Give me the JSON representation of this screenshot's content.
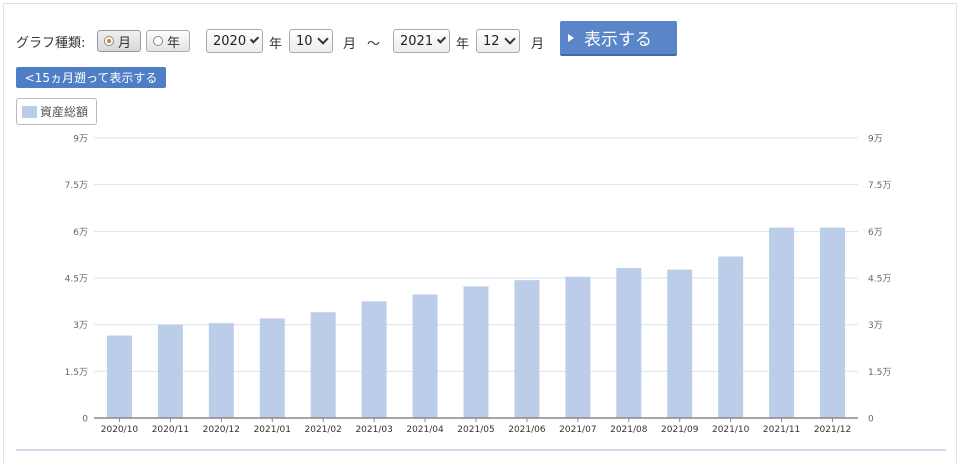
{
  "controls": {
    "graph_type_label": "グラフ種類:",
    "month_option": "月",
    "year_option": "年",
    "start_year": "2020",
    "year_unit_1": "年",
    "start_month": "10",
    "month_unit_1": "月",
    "range_sep": "～",
    "end_year": "2021",
    "year_unit_2": "年",
    "end_month": "12",
    "month_unit_2": "月",
    "show_button": "表示する",
    "back_button": "<15ヵ月遡って表示する"
  },
  "legend": {
    "label": "資産総額"
  },
  "colors": {
    "bar": "#bccde9",
    "button": "#5a86c9",
    "grid": "#dde3ea"
  },
  "chart_data": {
    "type": "bar",
    "title": "",
    "xlabel": "",
    "ylabel": "",
    "categories": [
      "2020/10",
      "2020/11",
      "2020/12",
      "2021/01",
      "2021/02",
      "2021/03",
      "2021/04",
      "2021/05",
      "2021/06",
      "2021/07",
      "2021/08",
      "2021/09",
      "2021/10",
      "2021/11",
      "2021/12"
    ],
    "series": [
      {
        "name": "資産総額",
        "values": [
          26500,
          30000,
          30500,
          32000,
          34000,
          37500,
          39700,
          42300,
          44300,
          45400,
          48200,
          47700,
          51900,
          61200,
          61200
        ]
      }
    ],
    "ylim": [
      0,
      90000
    ],
    "y_ticks": [
      0,
      15000,
      30000,
      45000,
      60000,
      75000,
      90000
    ],
    "y_tick_labels": [
      "0",
      "1.5万",
      "3万",
      "4.5万",
      "6万",
      "7.5万",
      "9万"
    ],
    "right_axis_tick_labels": [
      "0",
      "1.5万",
      "3万",
      "4.5万",
      "6万",
      "7.5万",
      "9万"
    ],
    "grid": true,
    "legend_position": "top-left"
  }
}
